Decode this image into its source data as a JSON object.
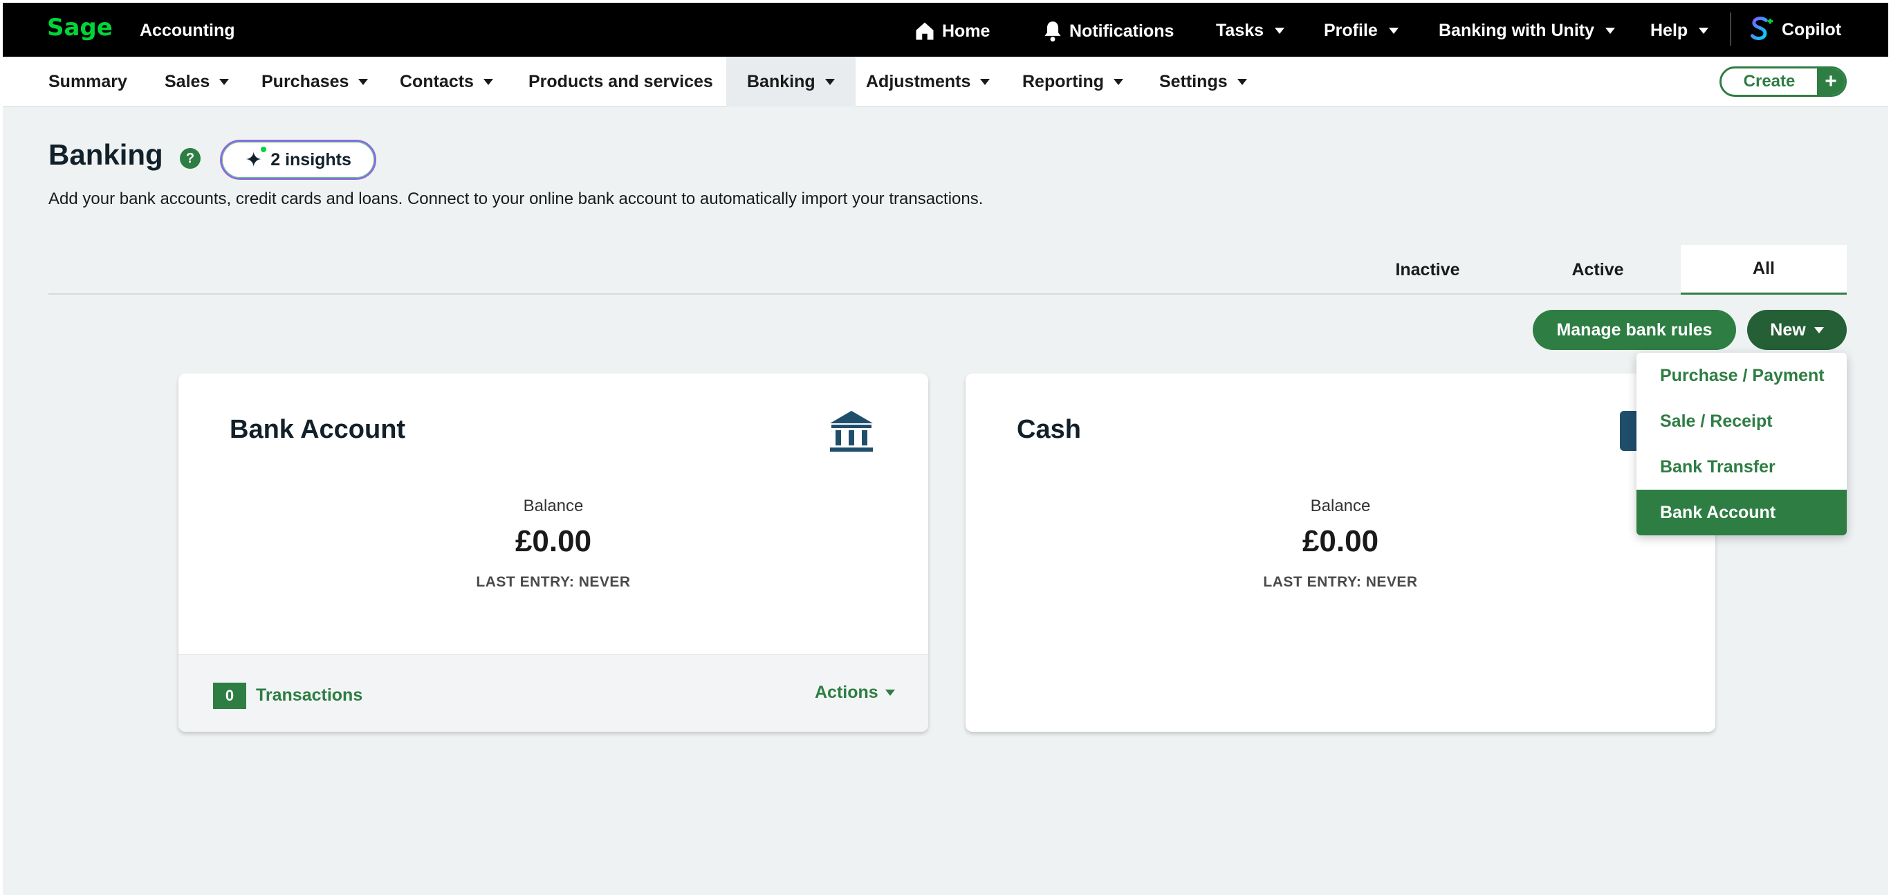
{
  "app": {
    "logo": "Sage",
    "name": "Accounting"
  },
  "topbar": {
    "home": "Home",
    "notifications": "Notifications",
    "tasks": "Tasks",
    "profile": "Profile",
    "business": "Banking with Unity",
    "help": "Help",
    "copilot": "Copilot"
  },
  "nav": {
    "items": [
      "Summary",
      "Sales",
      "Purchases",
      "Contacts",
      "Products and services",
      "Banking",
      "Adjustments",
      "Reporting",
      "Settings"
    ],
    "active": "Banking",
    "create": "Create"
  },
  "header": {
    "title": "Banking",
    "insights": "2 insights",
    "subtitle": "Add your bank accounts, credit cards and loans. Connect to your online bank account to automatically import your transactions."
  },
  "tabs": {
    "items": [
      "Inactive",
      "Active",
      "All"
    ],
    "active": "All"
  },
  "actions": {
    "manage_rules": "Manage bank rules",
    "new": "New"
  },
  "new_menu": {
    "items": [
      "Purchase / Payment",
      "Sale / Receipt",
      "Bank Transfer",
      "Bank Account"
    ],
    "highlighted": "Bank Account"
  },
  "cards": [
    {
      "title": "Bank Account",
      "icon": "bank-icon",
      "balance_label": "Balance",
      "balance": "£0.00",
      "last_entry": "LAST ENTRY: NEVER",
      "transactions_count": "0",
      "transactions_label": "Transactions",
      "actions_label": "Actions"
    },
    {
      "title": "Cash",
      "balance_label": "Balance",
      "balance": "£0.00",
      "last_entry": "LAST ENTRY: NEVER"
    }
  ],
  "colors": {
    "brand_green": "#2e7d43",
    "logo_green": "#00d639",
    "topbar": "#000000",
    "page_bg": "#eef2f3"
  }
}
